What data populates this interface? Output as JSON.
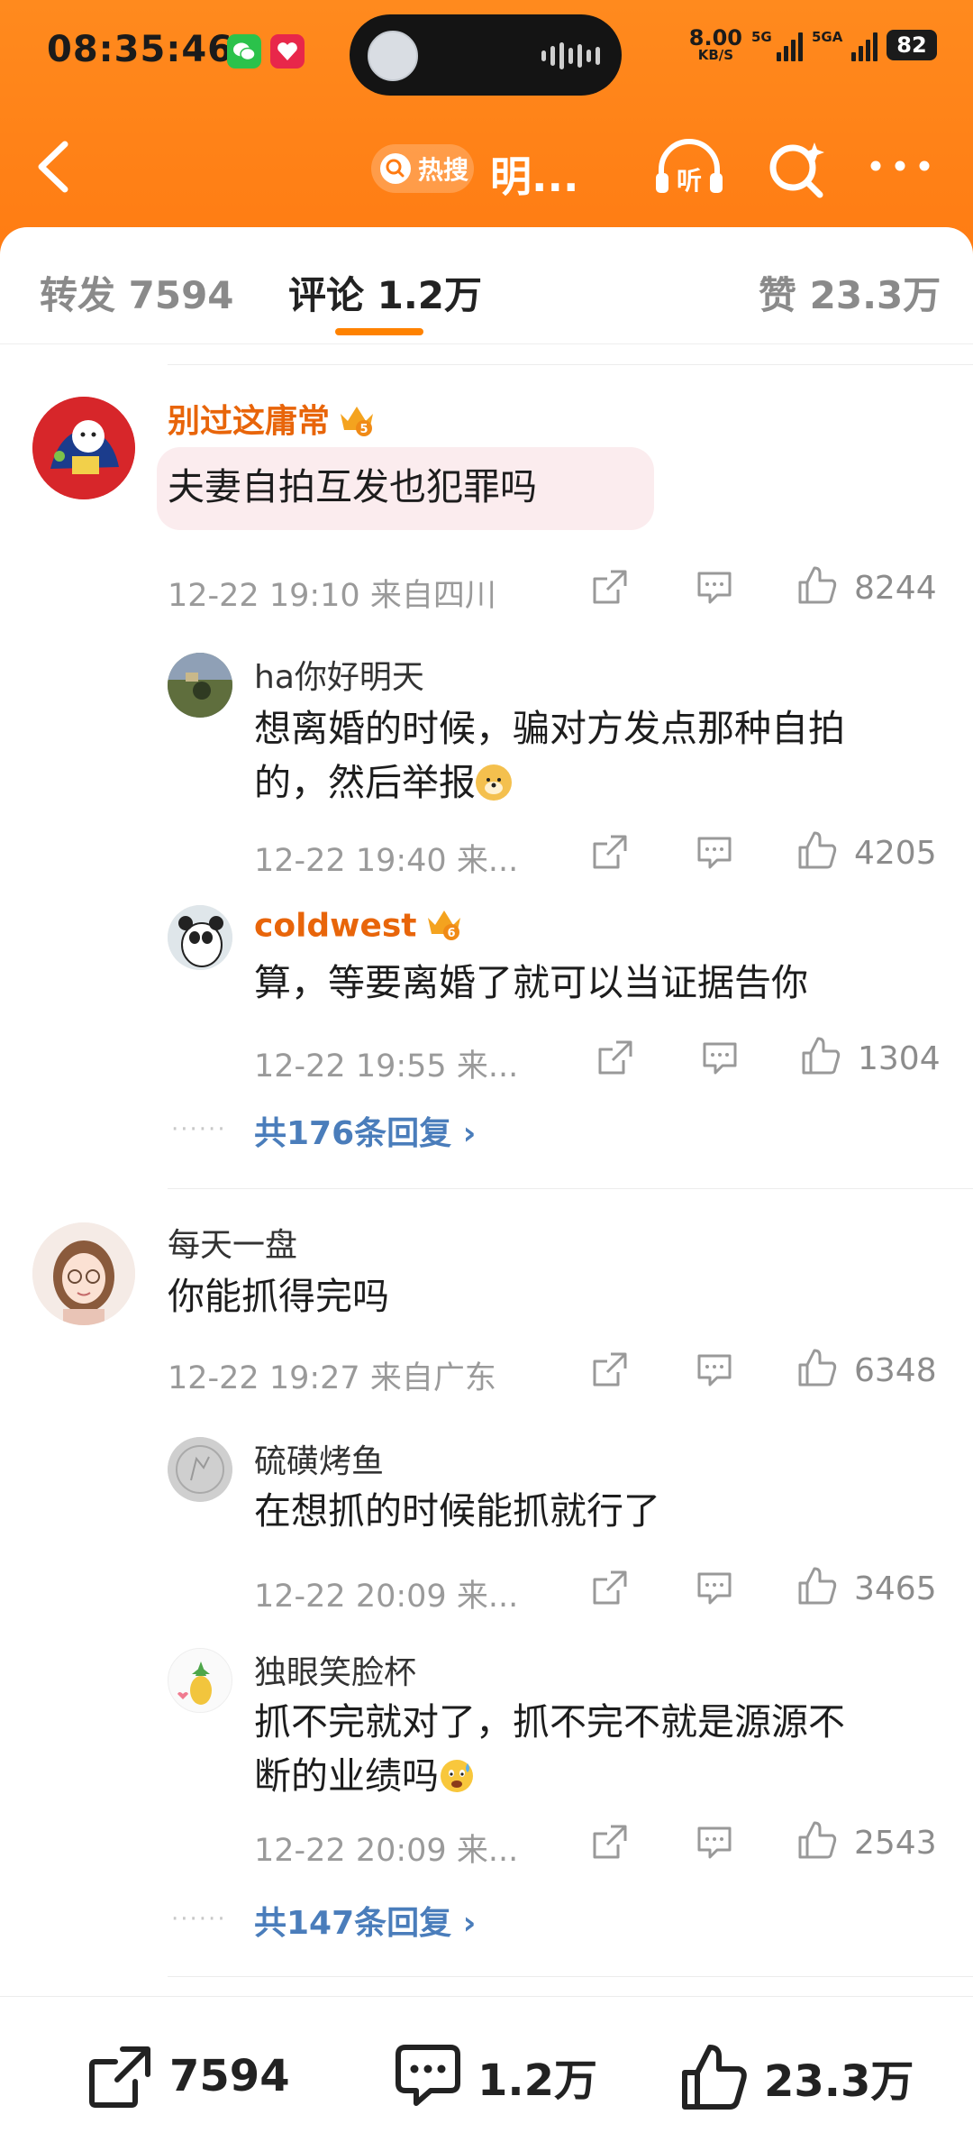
{
  "status_bar": {
    "time": "08:35:46",
    "net_speed_value": "8.00",
    "net_speed_unit": "KB/S",
    "sig1_label": "5G",
    "sig2_label": "5GA",
    "battery": "82"
  },
  "nav": {
    "hot_label": "热搜",
    "topic_title": "明..."
  },
  "tabs": {
    "repost": "转发 7594",
    "comments": "评论 1.2万",
    "likes": "赞 23.3万"
  },
  "comments": [
    {
      "user": "别过这庸常",
      "text": "夫妻自拍互发也犯罪吗",
      "meta": "12-22 19:10  来自四川",
      "likes": "8244",
      "replies": [
        {
          "user": "ha你好明天",
          "line1": "想离婚的时候，骗对方发点那种自拍",
          "line2": "的，然后举报",
          "meta": "12-22 19:40  来...",
          "likes": "4205"
        },
        {
          "user": "coldwest",
          "line1": "算，等要离婚了就可以当证据告你",
          "meta": "12-22 19:55  来...",
          "likes": "1304"
        }
      ],
      "more": "共176条回复 ›"
    },
    {
      "user": "每天一盘",
      "text": "你能抓得完吗",
      "meta": "12-22 19:27  来自广东",
      "likes": "6348",
      "replies": [
        {
          "user": "硫磺烤鱼",
          "line1": "在想抓的时候能抓就行了",
          "meta": "12-22 20:09  来...",
          "likes": "3465"
        },
        {
          "user": "独眼笑脸杯",
          "line1": "抓不完就对了，抓不完不就是源源不",
          "line2": "断的业绩吗",
          "meta": "12-22 20:09  来...",
          "likes": "2543"
        }
      ],
      "more": "共147条回复 ›"
    }
  ],
  "bottom_bar": {
    "repost": "7594",
    "comment": "1.2万",
    "like": "23.3万"
  },
  "colors": {
    "header": "#ff7b12",
    "accent": "#ff8200",
    "username_vip": "#e8650a",
    "link": "#4a7dbb"
  }
}
